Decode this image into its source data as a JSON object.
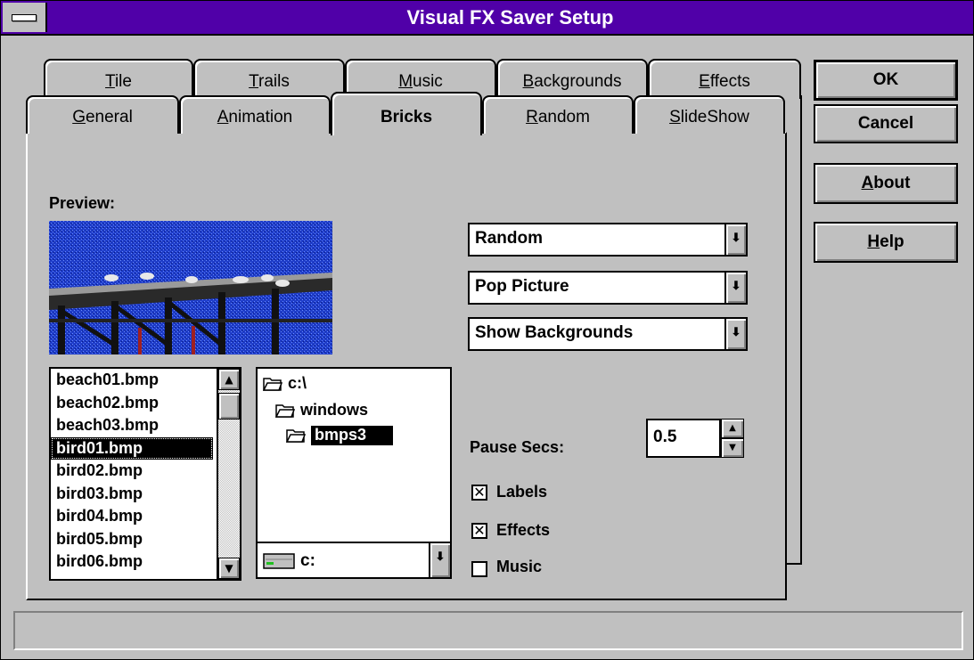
{
  "window": {
    "title": "Visual FX Saver Setup"
  },
  "tabs": {
    "top_row": [
      {
        "label": "Tile",
        "u": "T",
        "rest": "ile"
      },
      {
        "label": "Trails",
        "u": "T",
        "rest": "rails"
      },
      {
        "label": "Music",
        "u": "M",
        "rest": "usic"
      },
      {
        "label": "Backgrounds",
        "u": "B",
        "rest": "ackgrounds"
      },
      {
        "label": "Effects",
        "u": "E",
        "rest": "ffects"
      }
    ],
    "bottom_row": [
      {
        "label": "General",
        "u": "G",
        "rest": "eneral"
      },
      {
        "label": "Animation",
        "u": "A",
        "rest": "nimation"
      },
      {
        "label": "Bricks"
      },
      {
        "label": "Random",
        "u": "R",
        "rest": "andom"
      },
      {
        "label": "SlideShow",
        "u": "S",
        "rest": "lideShow"
      }
    ],
    "active": "Bricks"
  },
  "preview": {
    "label": "Preview:"
  },
  "dropdowns": {
    "mode": "Random",
    "effect": "Pop Picture",
    "background": "Show Backgrounds"
  },
  "files": [
    "beach01.bmp",
    "beach02.bmp",
    "beach03.bmp",
    "bird01.bmp",
    "bird02.bmp",
    "bird03.bmp",
    "bird04.bmp",
    "bird05.bmp",
    "bird06.bmp"
  ],
  "selected_file": "bird01.bmp",
  "directories": [
    "c:\\",
    "windows",
    "bmps3"
  ],
  "drive": "c:",
  "pause": {
    "label": "Pause Secs:",
    "value": "0.5"
  },
  "checkboxes": [
    {
      "label": "Labels",
      "checked": true
    },
    {
      "label": "Effects",
      "checked": true
    },
    {
      "label": "Music",
      "checked": false
    }
  ],
  "buttons": {
    "ok": "OK",
    "cancel": "Cancel",
    "about": {
      "u": "A",
      "rest": "bout"
    },
    "help": {
      "u": "H",
      "rest": "elp"
    }
  },
  "icons": {
    "system_menu": "system-menu-icon",
    "dropdown_arrow": "arrow-down-icon",
    "folder": "folder-open-icon",
    "drive": "drive-icon"
  }
}
